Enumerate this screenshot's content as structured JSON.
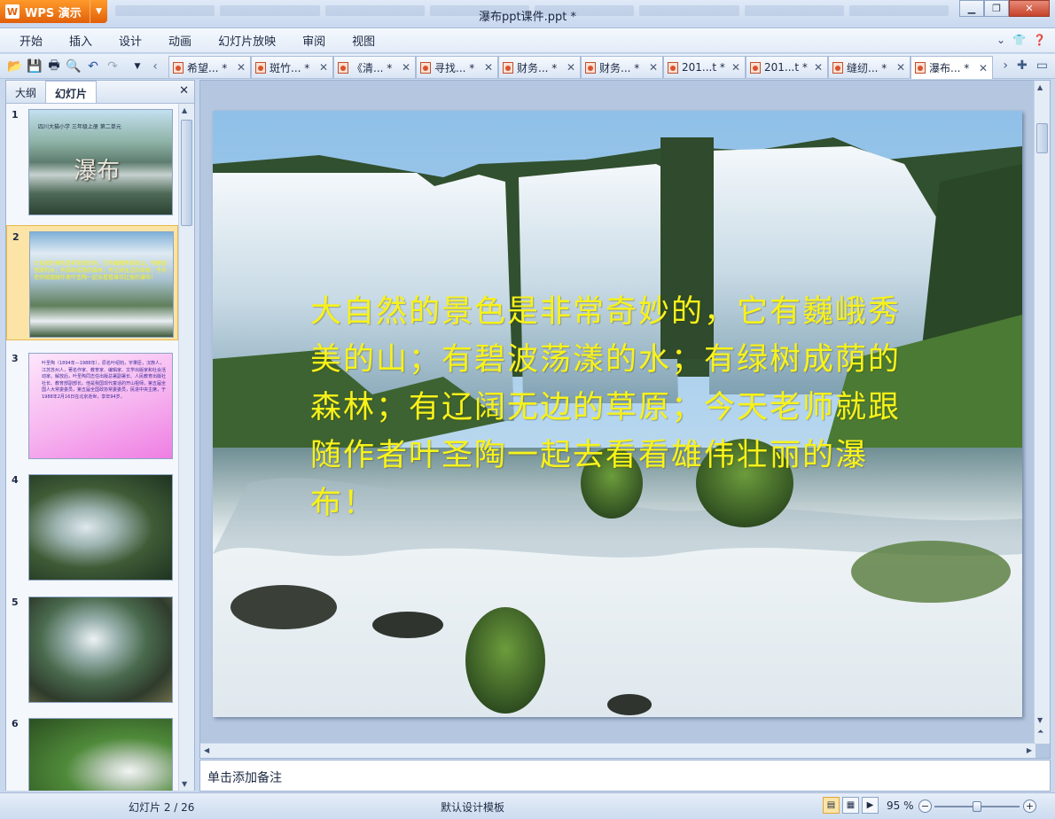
{
  "app": {
    "name": "WPS 演示",
    "logo_letter": "W"
  },
  "window": {
    "title": "瀑布ppt课件.ppt *"
  },
  "menu": [
    "开始",
    "插入",
    "设计",
    "动画",
    "幻灯片放映",
    "审阅",
    "视图"
  ],
  "doc_tabs": [
    {
      "label": "希望... *",
      "active": false
    },
    {
      "label": "斑竹... *",
      "active": false
    },
    {
      "label": "《清... *",
      "active": false
    },
    {
      "label": "寻找... *",
      "active": false
    },
    {
      "label": "财务... *",
      "active": false
    },
    {
      "label": "财务... *",
      "active": false
    },
    {
      "label": "201...t *",
      "active": false
    },
    {
      "label": "201...t *",
      "active": false
    },
    {
      "label": "缝纫... *",
      "active": false
    },
    {
      "label": "瀑布... *",
      "active": true
    }
  ],
  "pane": {
    "tab_outline": "大纲",
    "tab_slides": "幻灯片"
  },
  "thumbnails": [
    {
      "num": "1",
      "title_line": "四川大猫小学 三年级上册 第二单元",
      "title": "瀑布"
    },
    {
      "num": "2",
      "selected": true,
      "text": "大自然的景色是非常奇妙的，它有巍峨秀美的山；有碧波荡漾的水；有绿树成荫的森林；有辽阔无边的草原；今天老师就跟随作者叶圣陶一起去看看雄伟壮丽的瀑布！"
    },
    {
      "num": "3",
      "text": "叶圣陶（1894年—1988年），原名叶绍钧，字秉臣，汉族人，江苏苏州人，著名作家、教育家、编辑家、文学出版家和社会活动家。解放后，叶圣陶同志任出版总署副署长、人民教育出版社社长、教育部副部长。他是我国现代童话的开山祖师，第五届全国人大常委委员，第五届全国政协常委委员，民进中央主席，于1988年2月16日在北京逝世，享年94岁。"
    },
    {
      "num": "4"
    },
    {
      "num": "5"
    },
    {
      "num": "6"
    }
  ],
  "slide": {
    "text": "大自然的景色是非常奇妙的，它有巍峨秀美的山；有碧波荡漾的水；有绿树成荫的森林；有辽阔无边的草原；今天老师就跟随作者叶圣陶一起去看看雄伟壮丽的瀑布！",
    "text_color": "#f7f21a"
  },
  "notes": {
    "placeholder": "单击添加备注"
  },
  "status": {
    "slide_pos": "幻灯片 2 / 26",
    "template": "默认设计模板",
    "zoom": "95 %",
    "zoom_level": 0.5
  }
}
